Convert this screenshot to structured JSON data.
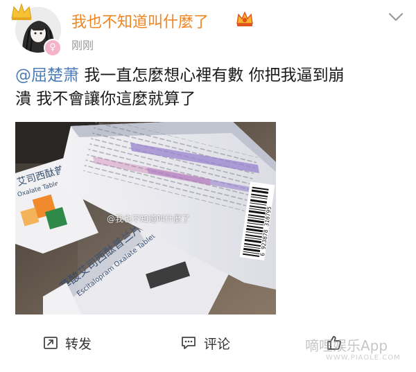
{
  "post": {
    "username": "我也不知道叫什麼了",
    "timestamp": "刚刚",
    "text_lines": [
      {
        "mention": "@屈楚萧",
        "rest": " 我一直怎麼想心裡有數 你把我逼到崩"
      },
      {
        "mention": "",
        "rest": "潰 我不會讓你這麼就算了"
      }
    ],
    "image": {
      "watermark": "@我也不知道叫什麼了",
      "box_brand_cn": "草酸艾司西酞普兰片",
      "box_brand_en": "Escitalopram Oxalate Tablets",
      "barcode_number": "6 923878 310795"
    }
  },
  "actions": {
    "repost_label": "转发",
    "comment_label": "评论"
  },
  "watermark": {
    "main": "嘀哩娱乐App",
    "sub": "WWW.PIAOLE.COM"
  },
  "colors": {
    "username": "#f28520",
    "mention": "#4c7bb6",
    "timestamp": "#9a9a9a"
  }
}
